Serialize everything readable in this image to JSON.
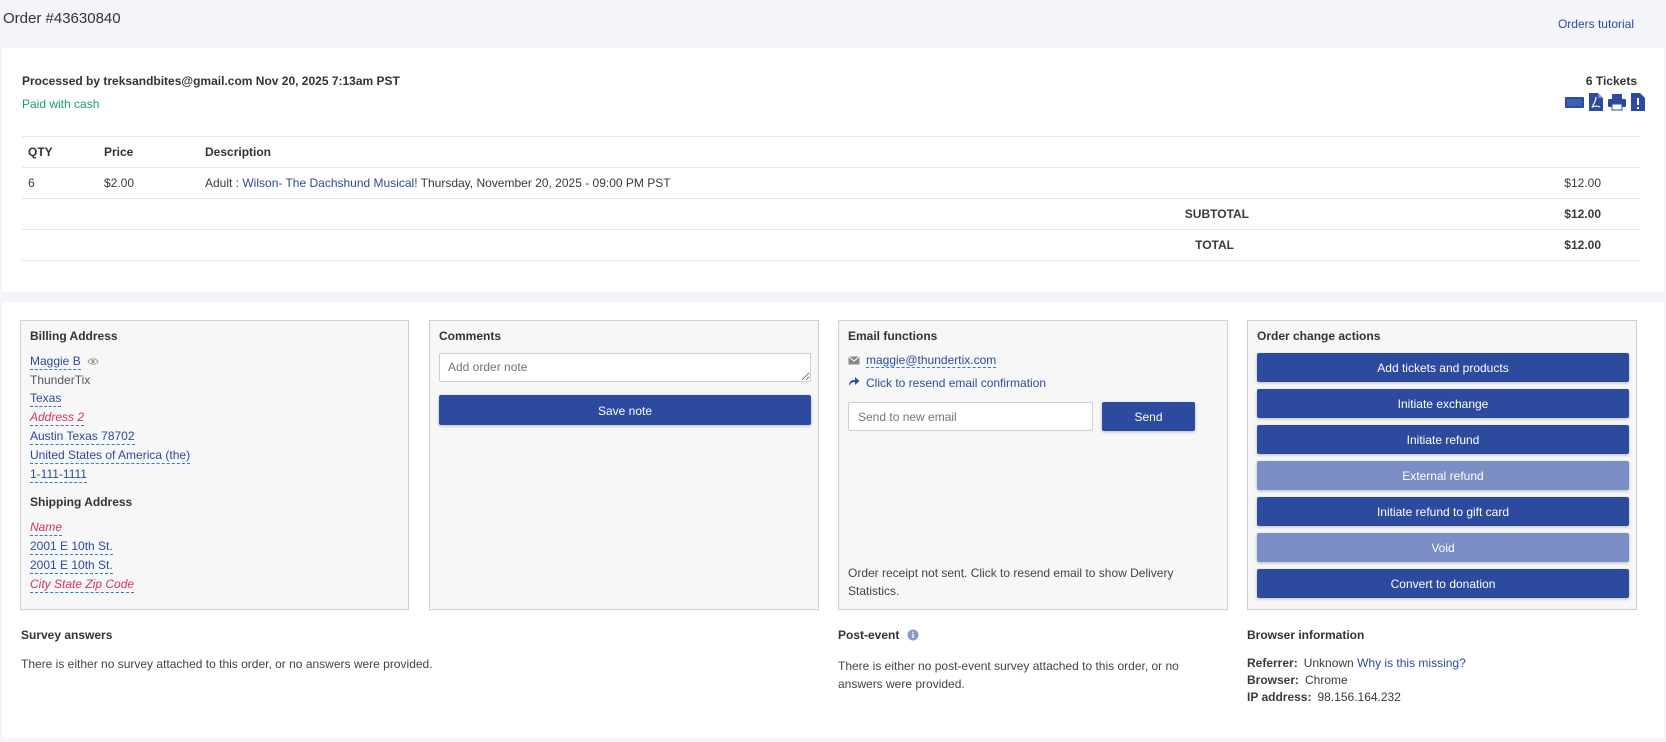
{
  "header": {
    "title": "Order #43630840",
    "tutorial_link": "Orders tutorial"
  },
  "summary": {
    "processed_by": "Processed by treksandbites@gmail.com Nov 20, 2025 7:13am PST",
    "payment": "Paid with cash",
    "tickets_count": "6 Tickets",
    "ticket_icons": [
      "ticket-icon",
      "pdf-icon",
      "printer-icon",
      "ticket-alert-icon"
    ],
    "columns": [
      "QTY",
      "Price",
      "Description"
    ],
    "items": [
      {
        "qty": "6",
        "price": "$2.00",
        "type": "Adult : ",
        "event": "Wilson- The Dachshund Musical!",
        "date": " Thursday, November 20, 2025 - 09:00 PM PST",
        "amount": "$12.00"
      }
    ],
    "subtotal_label": "SUBTOTAL",
    "subtotal": "$12.00",
    "total_label": "TOTAL",
    "total": "$12.00"
  },
  "billing": {
    "title": "Billing Address",
    "name": "Maggie B",
    "company": "ThunderTix",
    "state": "Texas",
    "address2": "Address 2",
    "city_line": "Austin Texas 78702",
    "country": "United States of America (the)",
    "phone": "1-111-1111",
    "shipping_title": "Shipping Address",
    "ship_name": "Name",
    "ship_street1": "2001 E 10th St.",
    "ship_street2": "2001 E 10th St.",
    "ship_city": "City State Zip Code"
  },
  "comments": {
    "title": "Comments",
    "placeholder": "Add order note",
    "save_label": "Save note"
  },
  "email": {
    "title": "Email functions",
    "address": "maggie@thundertix.com",
    "resend": "Click to resend email confirmation",
    "new_email_placeholder": "Send to new email",
    "send_label": "Send",
    "receipt_status": "Order receipt not sent. Click to resend email to show Delivery Statistics."
  },
  "actions": {
    "title": "Order change actions",
    "buttons": [
      {
        "label": "Add tickets and products"
      },
      {
        "label": "Initiate exchange"
      },
      {
        "label": "Initiate refund"
      },
      {
        "label": "External refund"
      },
      {
        "label": "Initiate refund to gift card"
      },
      {
        "label": "Void"
      },
      {
        "label": "Convert to donation"
      }
    ]
  },
  "survey": {
    "title": "Survey answers",
    "text": "There is either no survey attached to this order, or no answers were provided."
  },
  "post_event": {
    "title": "Post-event",
    "text": "There is either no post-event survey attached to this order, or no answers were provided."
  },
  "browser_info": {
    "title": "Browser information",
    "referrer_label": "Referrer:",
    "referrer_value": "Unknown",
    "referrer_link": "Why is this missing?",
    "browser_label": "Browser:",
    "browser_value": "Chrome",
    "ip_label": "IP address:",
    "ip_value": "98.156.164.232"
  },
  "colors": {
    "primary": "#2c4a9e",
    "primary_disabled": "#7a8dc4",
    "paid_green": "#1a9b6e",
    "missing_red": "#d3345f"
  }
}
